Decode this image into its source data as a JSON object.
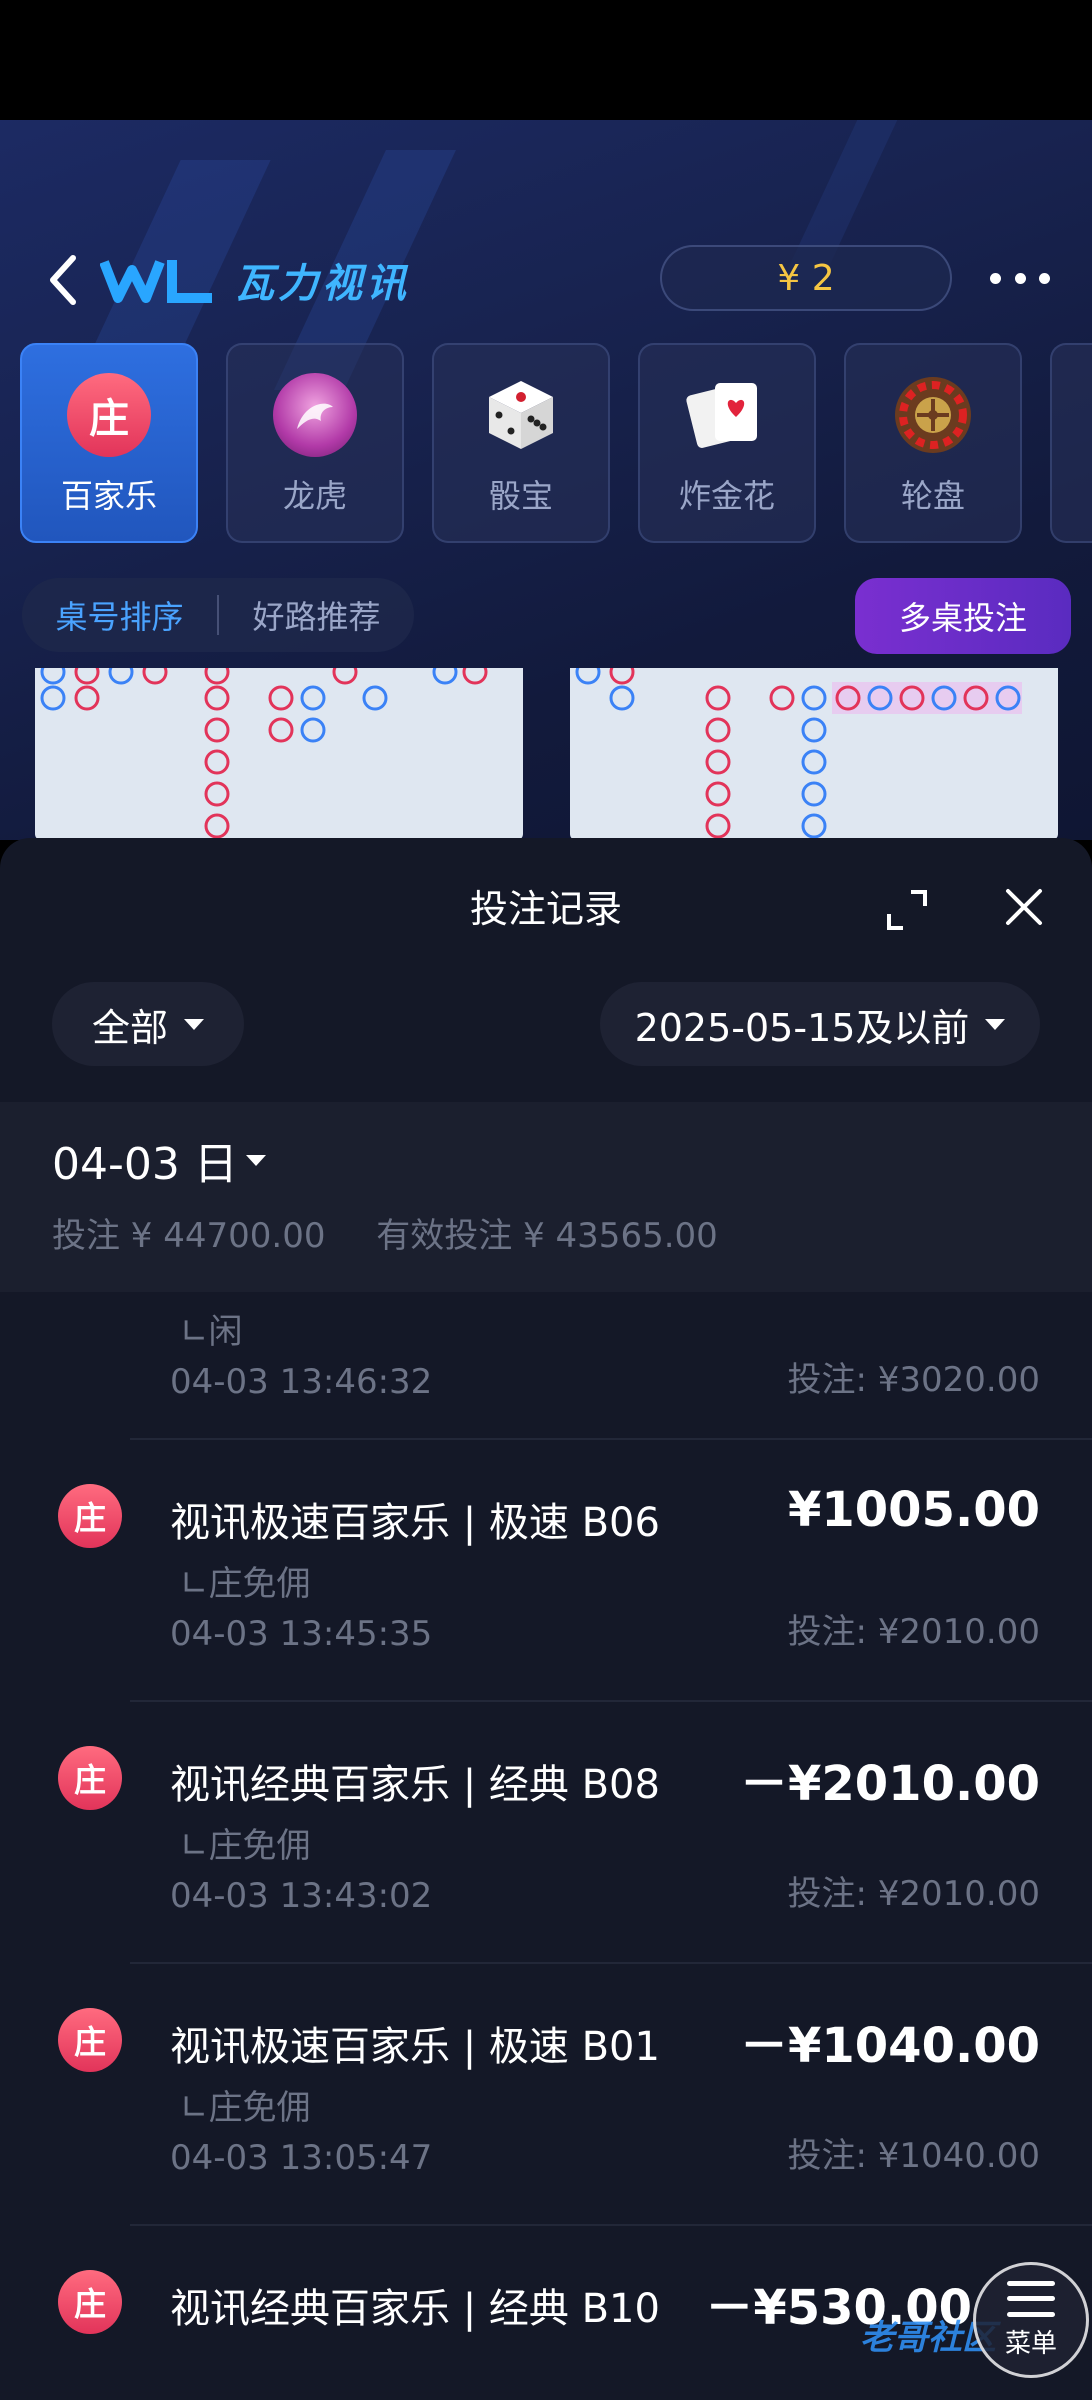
{
  "header": {
    "logo_text": "瓦力视讯",
    "balance": "¥ 2"
  },
  "games": [
    {
      "label": "百家乐",
      "icon": "banker-icon",
      "icon_text": "庄",
      "active": true
    },
    {
      "label": "龙虎",
      "icon": "dragon-icon",
      "active": false
    },
    {
      "label": "骰宝",
      "icon": "dice-icon",
      "active": false
    },
    {
      "label": "炸金花",
      "icon": "cards-icon",
      "active": false
    },
    {
      "label": "轮盘",
      "icon": "roulette-icon",
      "active": false
    }
  ],
  "tabs": {
    "items": [
      "桌号排序",
      "好路推荐"
    ],
    "multi_bet": "多桌投注"
  },
  "sheet": {
    "title": "投注记录",
    "filter_type": "全部",
    "filter_date": "2025-05-15及以前"
  },
  "day": {
    "title": "04-03 日",
    "total_bet": "投注 ¥ 44700.00",
    "valid_bet": "有效投注 ¥ 43565.00"
  },
  "records": [
    {
      "title": "",
      "sub": "∟闲",
      "time": "04-03 13:46:32",
      "amount": "",
      "stake": "投注: ¥3020.00"
    },
    {
      "icon_text": "庄",
      "title": "视讯极速百家乐 | 极速 B06",
      "sub": "∟庄免佣",
      "time": "04-03 13:45:35",
      "amount": "¥1005.00",
      "stake": "投注: ¥2010.00"
    },
    {
      "icon_text": "庄",
      "title": "视讯经典百家乐 | 经典 B08",
      "sub": "∟庄免佣",
      "time": "04-03 13:43:02",
      "amount": "－¥2010.00",
      "stake": "投注: ¥2010.00"
    },
    {
      "icon_text": "庄",
      "title": "视讯极速百家乐 | 极速 B01",
      "sub": "∟庄免佣",
      "time": "04-03 13:05:47",
      "amount": "－¥1040.00",
      "stake": "投注: ¥1040.00"
    },
    {
      "icon_text": "庄",
      "title": "视讯经典百家乐 | 经典 B10",
      "sub": "",
      "time": "",
      "amount": "－¥530.00",
      "stake": ""
    }
  ],
  "fab": {
    "label": "菜单"
  },
  "watermark": "老哥社区",
  "colors": {
    "accent": "#2e6fe0",
    "banker": "#e2345a",
    "player": "#3b82f6",
    "purple": "#7a2fd0",
    "gold": "#f5c542"
  }
}
